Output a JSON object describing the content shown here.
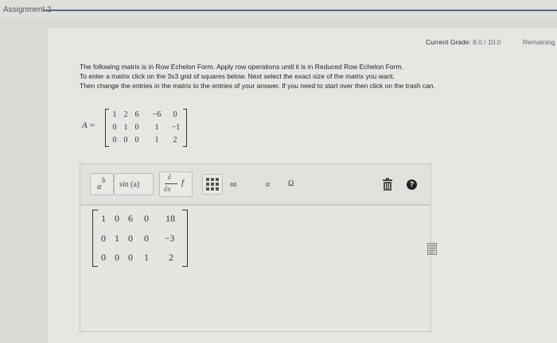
{
  "window": {
    "title": "Assignment 2"
  },
  "status": {
    "grade_label": "Current Grade:",
    "grade_value": "8.0 / 10.0",
    "remaining": "Remaining"
  },
  "instructions": [
    "The following matrix is in Row Echelon Form. Apply row operations until it is in Reduced Row Echelon Form.",
    "To enter a matrix click on the 3x3 grid of squares below. Next select the exact size of the matrix you want.",
    "Then change the entries in the matrix to the entries of your answer. If you need to start over then click on the trash can."
  ],
  "given_matrix": {
    "label": "A =",
    "rows": [
      [
        "1",
        "2",
        "6",
        "−6",
        "0"
      ],
      [
        "0",
        "1",
        "0",
        "1",
        "−1"
      ],
      [
        "0",
        "0",
        "0",
        "1",
        "2"
      ]
    ]
  },
  "toolbar": {
    "superscript": "a",
    "superscript_exp": "b",
    "sin_label": "sin (a)",
    "deriv_top": "∂",
    "deriv_bottom": "∂x",
    "deriv_f": "f",
    "infinity": "∞",
    "alpha": "α",
    "omega": "Ω",
    "help": "?"
  },
  "answer_matrix": {
    "rows": [
      [
        "1",
        "0",
        "6",
        "0",
        "18"
      ],
      [
        "0",
        "1",
        "0",
        "0",
        "−3"
      ],
      [
        "0",
        "0",
        "0",
        "1",
        "2"
      ]
    ]
  },
  "icons": [
    "trash-icon",
    "help-icon",
    "matrix-grid-icon",
    "document-icon"
  ]
}
